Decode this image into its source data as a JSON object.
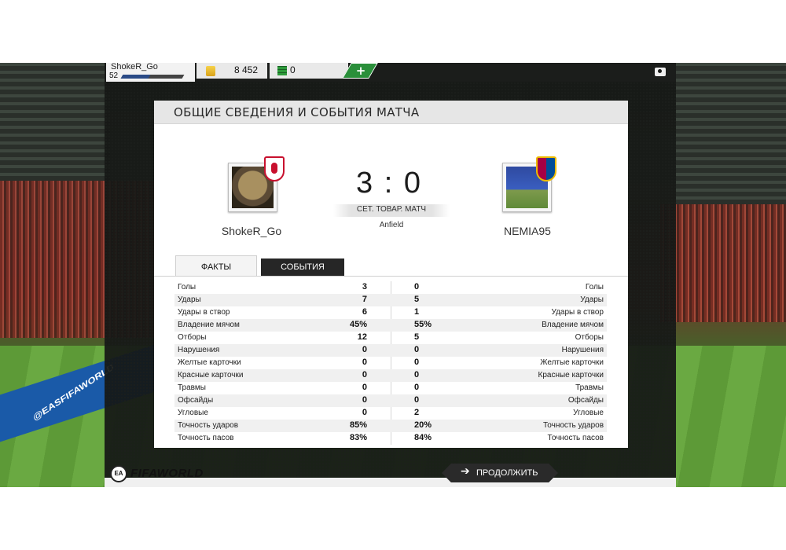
{
  "topbar": {
    "username": "ShokeR_Go",
    "level": "52",
    "xp_fraction": 0.45,
    "coins": "8 452",
    "points": "0",
    "add_label": "+"
  },
  "card": {
    "title": "ОБЩИЕ СВЕДЕНИЯ И СОБЫТИЯ МАТЧА",
    "score": "3 : 0",
    "match_type": "СЕТ. ТОВАР. МАТЧ",
    "stadium": "Anfield",
    "home_name": "ShokeR_Go",
    "away_name": "NEMIA95"
  },
  "tabs": {
    "facts": "ФАКТЫ",
    "events": "СОБЫТИЯ"
  },
  "stats": [
    {
      "label": "Голы",
      "home": "3",
      "away": "0"
    },
    {
      "label": "Удары",
      "home": "7",
      "away": "5"
    },
    {
      "label": "Удары в створ",
      "home": "6",
      "away": "1"
    },
    {
      "label": "Владение мячом",
      "home": "45%",
      "away": "55%"
    },
    {
      "label": "Отборы",
      "home": "12",
      "away": "5"
    },
    {
      "label": "Нарушения",
      "home": "0",
      "away": "0"
    },
    {
      "label": "Желтые карточки",
      "home": "0",
      "away": "0"
    },
    {
      "label": "Красные карточки",
      "home": "0",
      "away": "0"
    },
    {
      "label": "Травмы",
      "home": "0",
      "away": "0"
    },
    {
      "label": "Офсайды",
      "home": "0",
      "away": "0"
    },
    {
      "label": "Угловые",
      "home": "0",
      "away": "2"
    },
    {
      "label": "Точность ударов",
      "home": "85%",
      "away": "20%"
    },
    {
      "label": "Точность пасов",
      "home": "83%",
      "away": "84%"
    }
  ],
  "footer": {
    "ea_logo": "EA",
    "fifa_logo": "FIFAWORLD",
    "continue_label": "ПРОДОЛЖИТЬ",
    "continue_arrow": "➔"
  },
  "background": {
    "board_text": "@EASFIFAWORLD"
  },
  "colors": {
    "accent_green": "#2a8f3a",
    "dark_panel": "#1b1d1b",
    "liverpool_red": "#c8102e",
    "barca_blue": "#004d98"
  }
}
